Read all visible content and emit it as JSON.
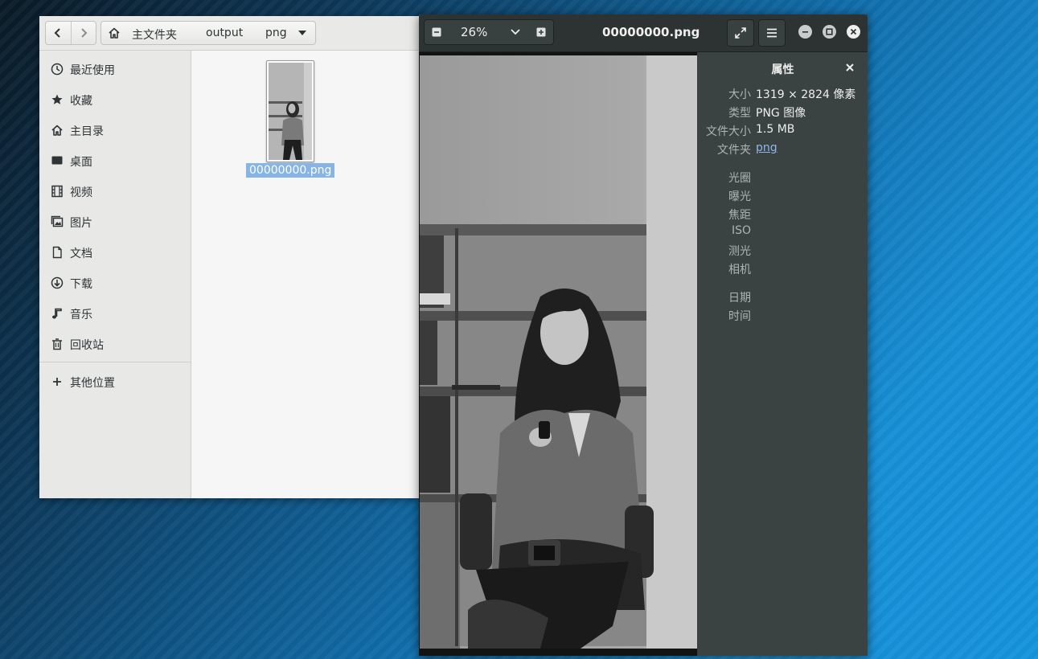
{
  "files": {
    "breadcrumb": {
      "home": "主文件夹",
      "c1": "output",
      "c2": "png"
    },
    "sidebar": [
      {
        "icon": "clock-icon",
        "label": "最近使用"
      },
      {
        "icon": "star-icon",
        "label": "收藏"
      },
      {
        "icon": "home-icon",
        "label": "主目录"
      },
      {
        "icon": "desktop-icon",
        "label": "桌面"
      },
      {
        "icon": "video-icon",
        "label": "视频"
      },
      {
        "icon": "image-icon",
        "label": "图片"
      },
      {
        "icon": "document-icon",
        "label": "文档"
      },
      {
        "icon": "download-icon",
        "label": "下载"
      },
      {
        "icon": "music-icon",
        "label": "音乐"
      },
      {
        "icon": "trash-icon",
        "label": "回收站"
      },
      {
        "icon": "plus-icon",
        "label": "其他位置"
      }
    ],
    "file": {
      "name": "00000000.png"
    }
  },
  "viewer": {
    "zoom": "26%",
    "title": "00000000.png",
    "properties": {
      "title": "属性",
      "rows": [
        {
          "key": "大小",
          "value": "1319 × 2824 像素"
        },
        {
          "key": "类型",
          "value": "PNG 图像"
        },
        {
          "key": "文件大小",
          "value": "1.5 MB"
        },
        {
          "key": "文件夹",
          "value": "png",
          "link": true
        }
      ],
      "exif": [
        "光圈",
        "曝光",
        "焦距",
        "ISO",
        "测光",
        "相机"
      ],
      "datetime": [
        "日期",
        "时间"
      ]
    }
  }
}
